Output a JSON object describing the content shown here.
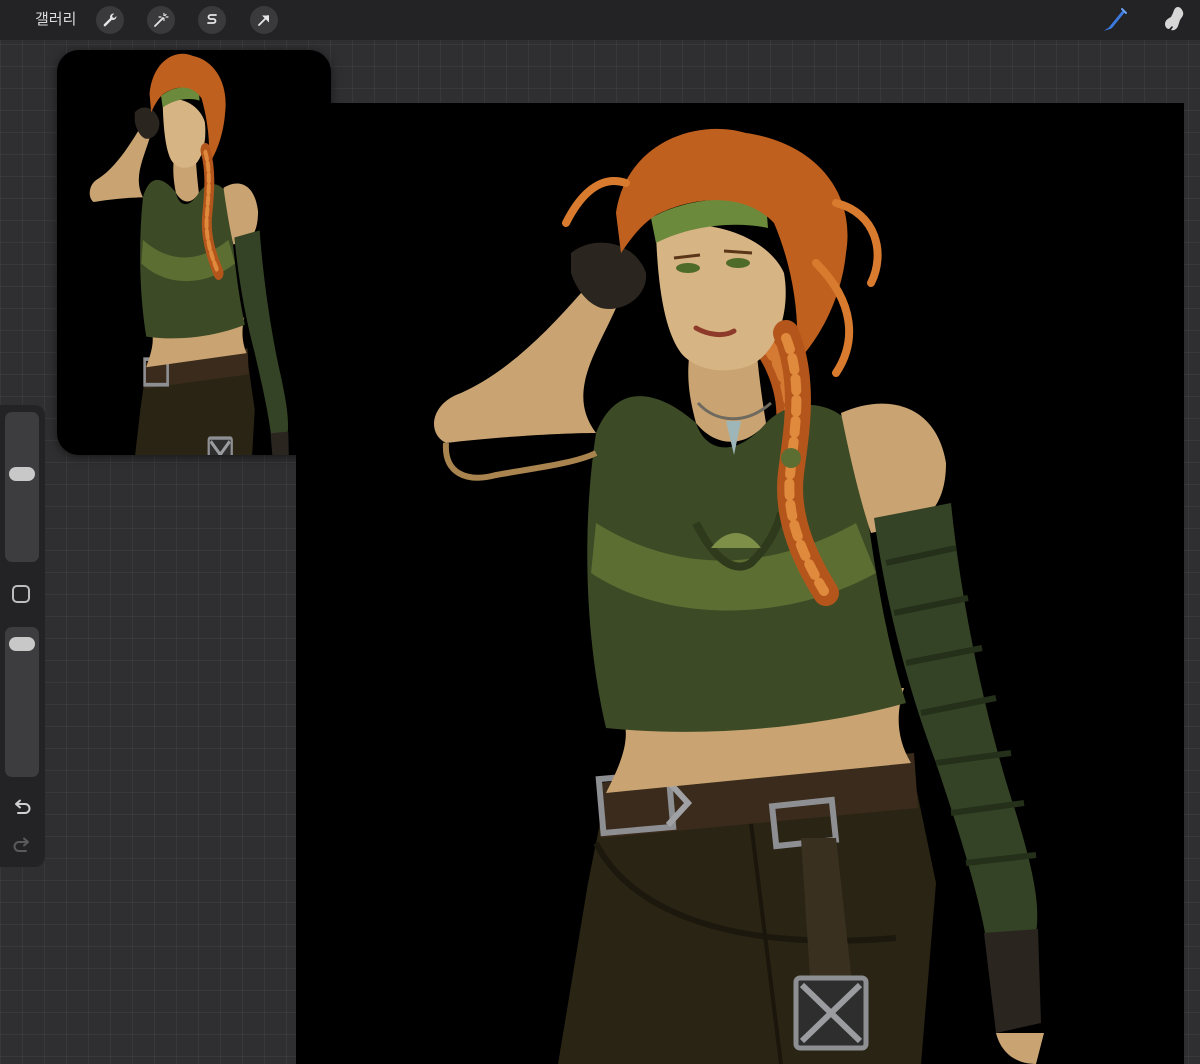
{
  "topbar": {
    "gallery_label": "갤러리",
    "tools": [
      "wrench-icon",
      "magic-wand-icon",
      "selection-icon",
      "transform-arrow-icon"
    ],
    "right_tools": [
      "brush-icon",
      "smudge-icon"
    ],
    "active_color": "#3b7be0"
  },
  "sidebar": {
    "brush_size_level": 0.6,
    "opacity_level": 0.95,
    "controls": [
      "brush-size-slider",
      "modifier-button",
      "opacity-slider",
      "undo-icon",
      "redo-icon"
    ]
  },
  "colors": {
    "ui_background": "#2f2f31",
    "bar_background": "#232325",
    "canvas_background": "#000000"
  }
}
